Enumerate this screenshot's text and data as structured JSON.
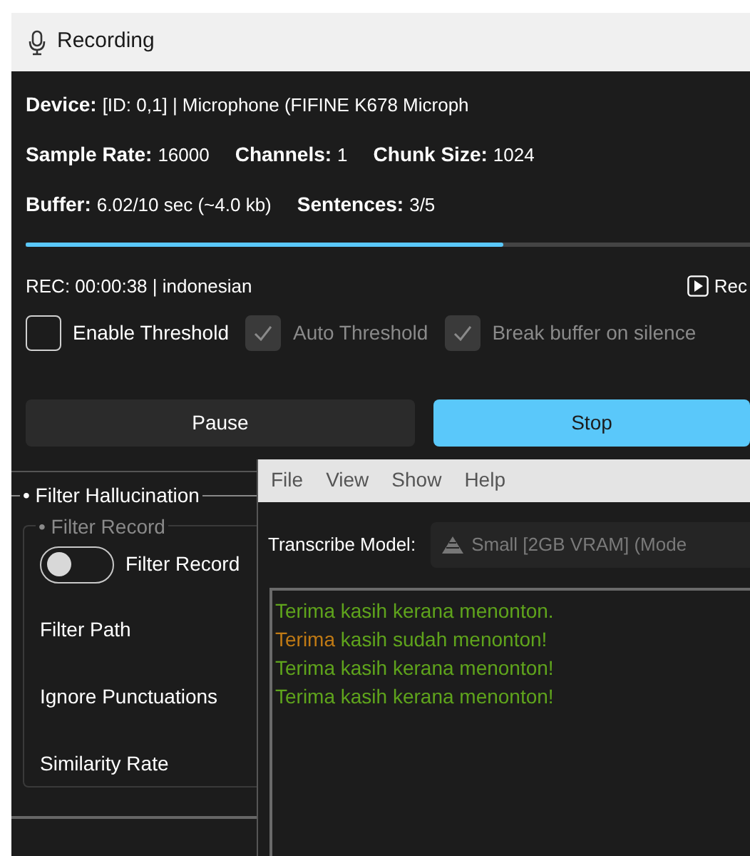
{
  "window": {
    "title": "Recording"
  },
  "info": {
    "device_label": "Device:",
    "device": "[ID: 0,1] | Microphone (FIFINE K678 Microph",
    "sample_rate_label": "Sample Rate:",
    "sample_rate": "16000",
    "channels_label": "Channels:",
    "channels": "1",
    "chunk_size_label": "Chunk Size:",
    "chunk_size": "1024",
    "buffer_label": "Buffer:",
    "buffer": "6.02/10 sec (~4.0 kb)",
    "sentences_label": "Sentences:",
    "sentences": "3/5"
  },
  "buffer_progress": {
    "level": 0.66
  },
  "status": {
    "text": "REC: 00:00:38 | indonesian",
    "record_button": "Rec"
  },
  "options": [
    {
      "label": "Enable Threshold",
      "checked": false,
      "disabled": false
    },
    {
      "label": "Auto Threshold",
      "checked": true,
      "disabled": true
    },
    {
      "label": "Break buffer on silence",
      "checked": true,
      "disabled": true
    }
  ],
  "buttons": [
    {
      "label": "Pause",
      "kind": "secondary"
    },
    {
      "label": "Stop",
      "kind": "primary"
    }
  ],
  "filter_panel": {
    "title": "• Filter Hallucination",
    "group_title": "• Filter Record",
    "toggle": {
      "label": "Filter Record",
      "on": false
    },
    "labels": [
      "Filter Path",
      "Ignore Punctuations",
      "Similarity Rate"
    ]
  },
  "transcribe_window": {
    "menu": [
      "File",
      "View",
      "Show",
      "Help"
    ],
    "model_label": "Transcribe Model:",
    "model_value": "Small [2GB VRAM] (Mode",
    "lines": [
      {
        "segments": [
          {
            "text": "Terima kasih kerana menonton.",
            "color": "#5fa41c"
          }
        ]
      },
      {
        "segments": [
          {
            "text": "Terima",
            "color": "#c07a14"
          },
          {
            "text": " kasih sudah menonton!",
            "color": "#5fa41c"
          }
        ]
      },
      {
        "segments": [
          {
            "text": "Terima kasih kerana menonton!",
            "color": "#5fa41c"
          }
        ]
      },
      {
        "segments": [
          {
            "text": "Terima kasih kerana menonton!",
            "color": "#5fa41c"
          }
        ]
      }
    ]
  }
}
